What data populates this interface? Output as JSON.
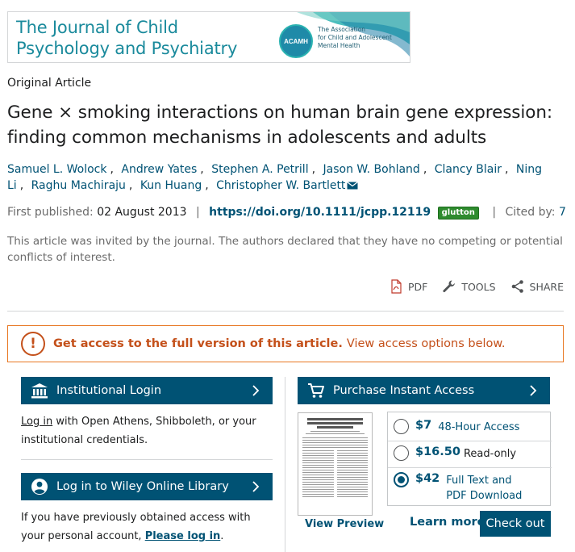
{
  "banner": {
    "journal_line1": "The Journal of Child",
    "journal_line2": "Psychology and Psychiatry",
    "acamh_logo_text": "ACAMH",
    "acamh_line1": "The Association",
    "acamh_line2": "for Child and Adolescent",
    "acamh_line3": "Mental Health"
  },
  "article": {
    "type": "Original Article",
    "title": "Gene × smoking interactions on human brain gene expression: finding common mechanisms in adolescents and adults",
    "authors": [
      "Samuel L. Wolock",
      "Andrew Yates",
      "Stephen A. Petrill",
      "Jason W. Bohland",
      "Clancy Blair",
      "Ning Li",
      "Raghu Machiraju",
      "Kun Huang",
      "Christopher W. Bartlett"
    ],
    "first_published_label": "First published:",
    "first_published_date": "02 August 2013",
    "doi": "https://doi.org/10.1111/jcpp.12119",
    "glutton_badge": "glutton",
    "cited_by_label": "Cited by:",
    "cited_by_count": "7",
    "disclosure": "This article was invited by the journal. The authors declared that they have no competing or potential conflicts of interest."
  },
  "tools": {
    "pdf_label": "PDF",
    "tools_label": "TOOLS",
    "share_label": "SHARE"
  },
  "access": {
    "exclamation": "!",
    "strong_text": "Get access to the full version of this article.",
    "light_text": "View access options below."
  },
  "institutional": {
    "button_label": "Institutional Login",
    "login_link": "Log in",
    "description": " with Open Athens, Shibboleth, or your institutional credentials."
  },
  "wiley": {
    "button_label": "Log in to Wiley Online Library",
    "description": "If you have previously obtained access with your personal account, ",
    "login_link": "Please log in",
    "period": "."
  },
  "purchase": {
    "button_label": "Purchase Instant Access",
    "view_preview": "View Preview",
    "options": [
      {
        "price": "$7",
        "desc": "48-Hour Access",
        "selected": false
      },
      {
        "price": "$16.50",
        "desc": "Read-only",
        "selected": false
      },
      {
        "price": "$42",
        "desc": "Full Text and PDF Download",
        "selected": true
      }
    ],
    "learn_more": "Learn more",
    "checkout": "Check out"
  },
  "colors": {
    "brand_blue": "#005274",
    "access_orange": "#c4501a",
    "journal_teal": "#1a8a9c"
  }
}
